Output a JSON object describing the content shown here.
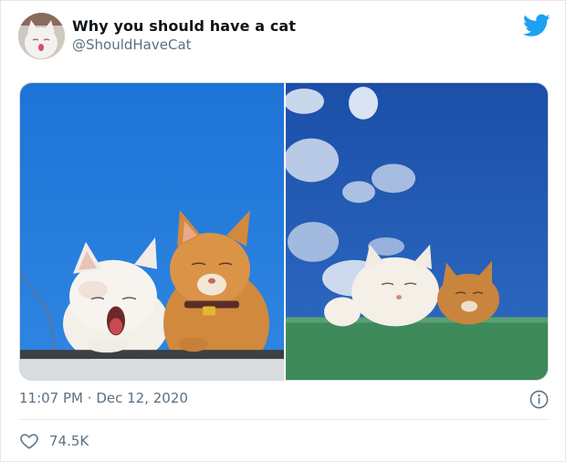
{
  "tweet": {
    "display_name": "Why you should have a cat",
    "handle": "@ShouldHaveCat",
    "time": "11:07 PM",
    "separator": "·",
    "date": "Dec 12, 2020",
    "like_count": "74.5K"
  },
  "icons": {
    "brand": "twitter-bird-icon",
    "info": "info-icon",
    "like": "heart-icon"
  },
  "colors": {
    "twitter_blue": "#1da1f2",
    "secondary_text": "#5b7083",
    "primary_text": "#0f1419",
    "divider": "#e1e8ed"
  }
}
